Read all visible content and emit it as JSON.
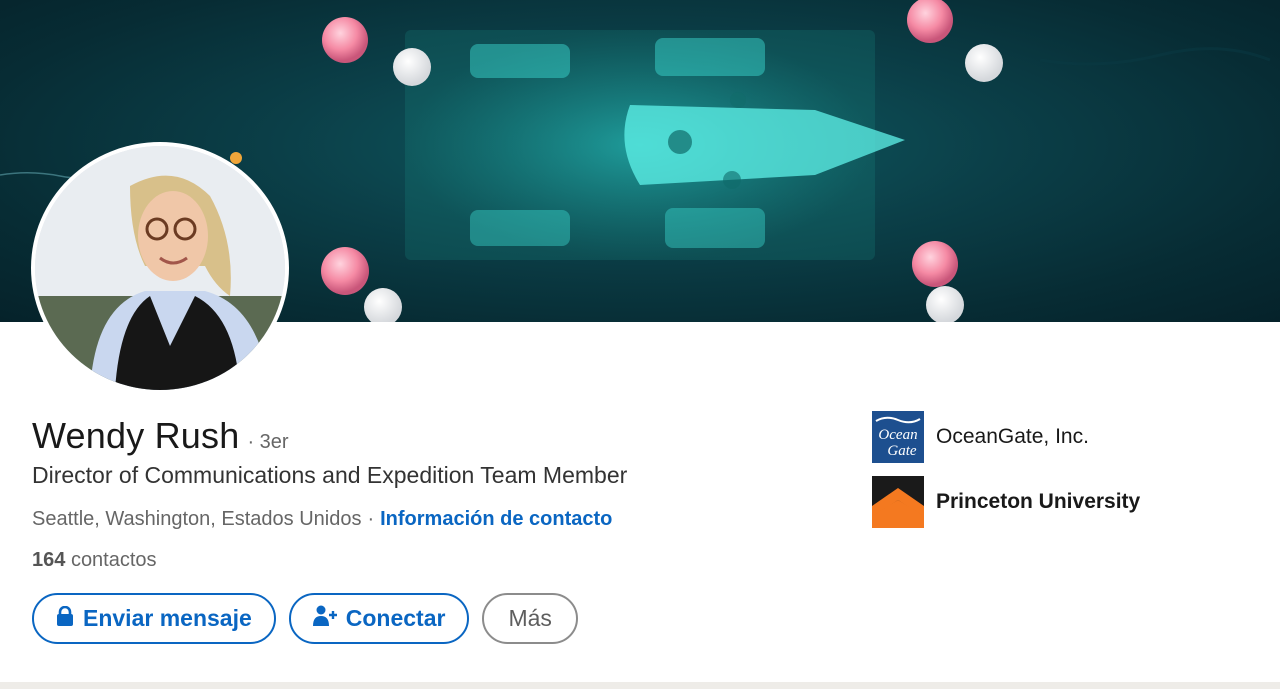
{
  "profile": {
    "name": "Wendy Rush",
    "degree": "· 3er",
    "headline": "Director of Communications and Expedition Team Member",
    "location": "Seattle, Washington, Estados Unidos",
    "separator": "·",
    "contact_info_label": "Información de contacto",
    "connections_count": "164",
    "connections_label": "contactos"
  },
  "actions": {
    "message_label": "Enviar mensaje",
    "connect_label": "Conectar",
    "more_label": "Más"
  },
  "organizations": [
    {
      "name": "OceanGate, Inc.",
      "logo_text_1": "Ocean",
      "logo_text_2": "Gate",
      "logo_color": "#1d4f8f"
    },
    {
      "name": "Princeton University",
      "logo_color": "#f47920"
    }
  ],
  "icons": {
    "message": "lock-icon",
    "connect": "add-person-icon"
  },
  "colors": {
    "accent": "#0a66c2",
    "banner": "#0b3f48"
  }
}
